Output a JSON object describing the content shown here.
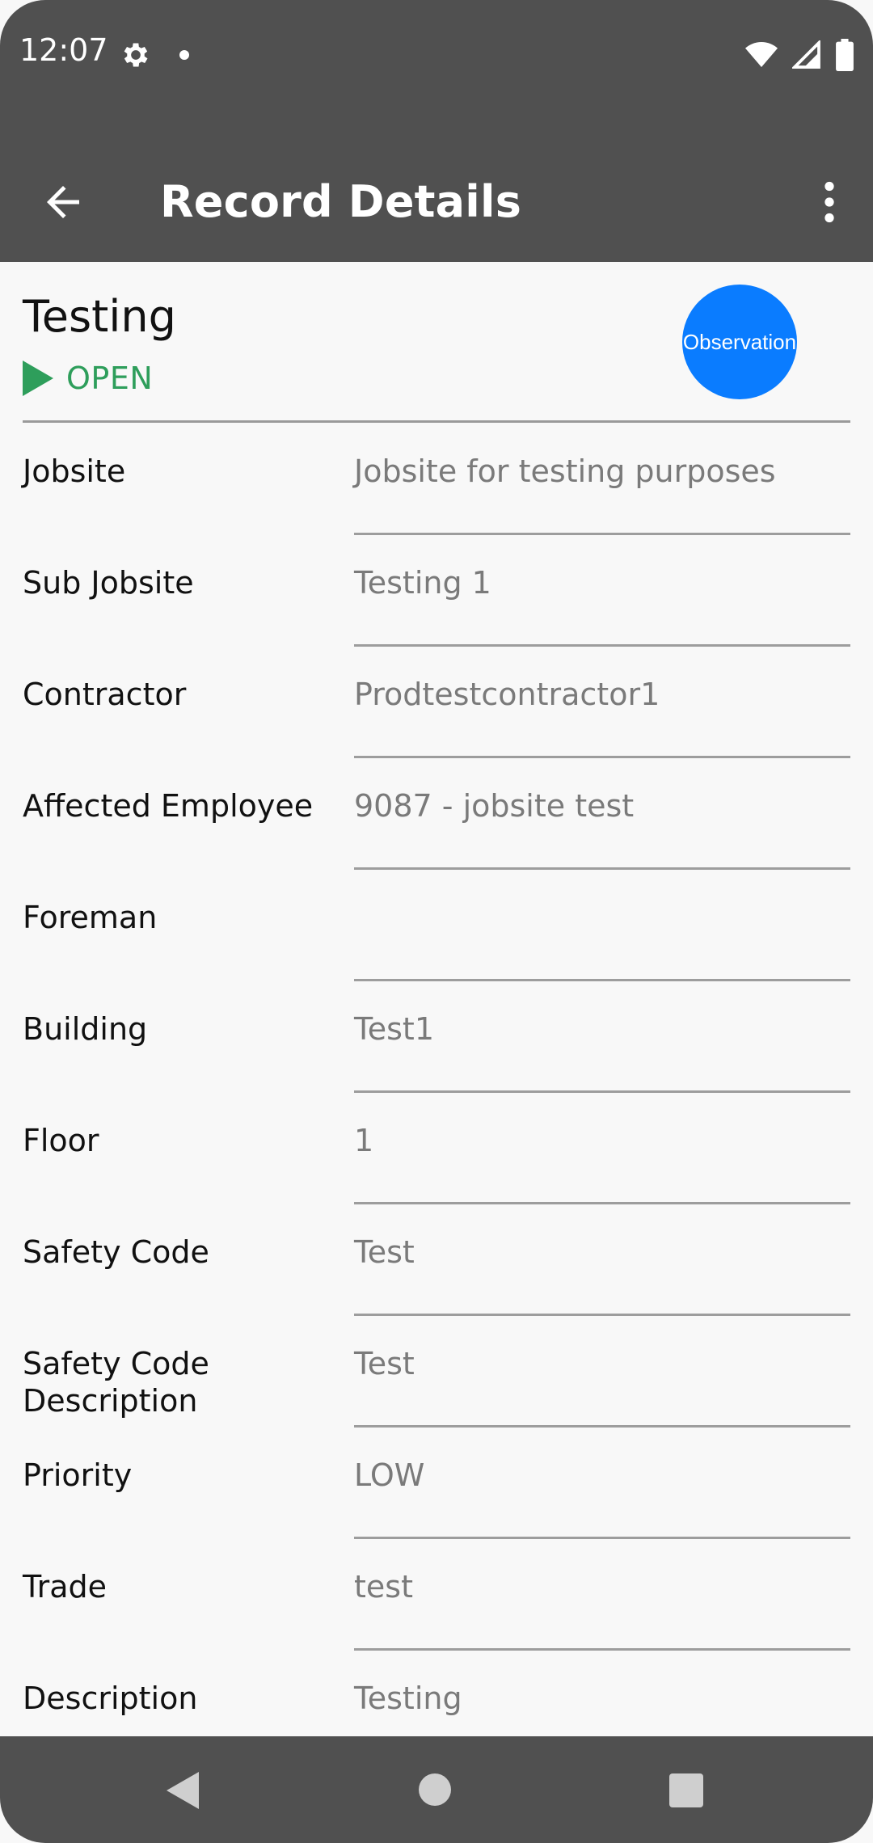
{
  "status_bar": {
    "time": "12:07",
    "icons": [
      "settings-gear-icon",
      "notification-dot-icon",
      "wifi-icon",
      "cell-signal-icon",
      "battery-icon"
    ]
  },
  "app_bar": {
    "title": "Record Details",
    "back_icon": "arrow-back-icon",
    "menu_icon": "more-vert-icon"
  },
  "record": {
    "title": "Testing",
    "status": "OPEN",
    "status_color": "#2e9e5b",
    "type": "Observation",
    "type_color": "#0a7cff"
  },
  "fields": [
    {
      "label": "Jobsite",
      "value": "Jobsite for testing purposes"
    },
    {
      "label": "Sub Jobsite",
      "value": "Testing 1"
    },
    {
      "label": "Contractor",
      "value": "Prodtestcontractor1"
    },
    {
      "label": "Affected Employee",
      "value": "9087 - jobsite test"
    },
    {
      "label": "Foreman",
      "value": ""
    },
    {
      "label": "Building",
      "value": "Test1"
    },
    {
      "label": "Floor",
      "value": "1"
    },
    {
      "label": "Safety Code",
      "value": "Test"
    },
    {
      "label": "Safety Code Description",
      "value": "Test"
    },
    {
      "label": "Priority",
      "value": "LOW"
    },
    {
      "label": "Trade",
      "value": "test"
    },
    {
      "label": "Description",
      "value": "Testing"
    }
  ],
  "nav_bar": {
    "icons": [
      "nav-back-icon",
      "nav-home-icon",
      "nav-recents-icon"
    ]
  }
}
